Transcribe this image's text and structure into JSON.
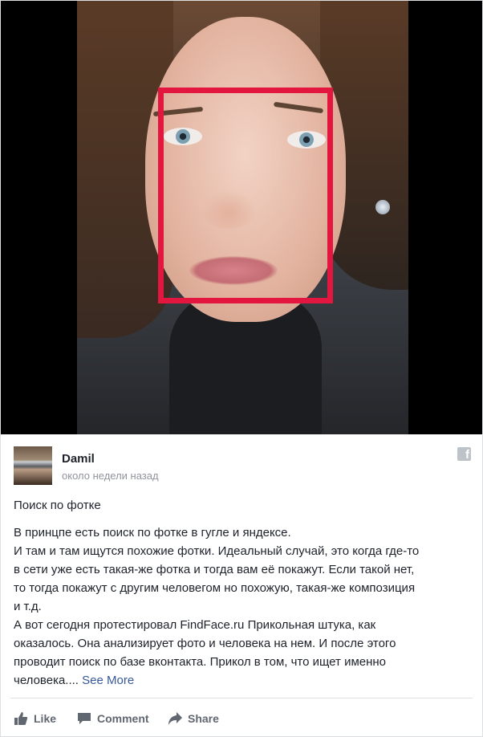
{
  "post": {
    "author": "Damil",
    "timestamp": "около недели назад",
    "title": "Поиск по фотке",
    "body_lines": [
      "В принцпе есть поиск по фотке в гугле и яндексе.",
      "И там и там ищутся похожие фотки. Идеальный случай, это когда где-то",
      "в сети уже есть такая-же фотка и тогда вам её покажут. Если такой нет,",
      "то тогда покажут с другим человегом но похожую, такая-же композиция",
      "и т.д.",
      "А вот сегодня протестировал FindFace.ru Прикольная штука, как",
      "оказалось. Она анализирует фото и человека на нем. И после этого",
      "проводит поиск по базе вконтакта. Прикол в том, что ищет именно"
    ],
    "last_line": "человека....",
    "see_more": "See More"
  },
  "actions": {
    "like": "Like",
    "comment": "Comment",
    "share": "Share"
  },
  "icons": {
    "facebook": "facebook-icon",
    "like": "thumbs-up-icon",
    "comment": "speech-bubble-icon",
    "share": "share-arrow-icon"
  },
  "colors": {
    "face_box": "#e3163f",
    "link": "#365899",
    "muted": "#90949c"
  }
}
